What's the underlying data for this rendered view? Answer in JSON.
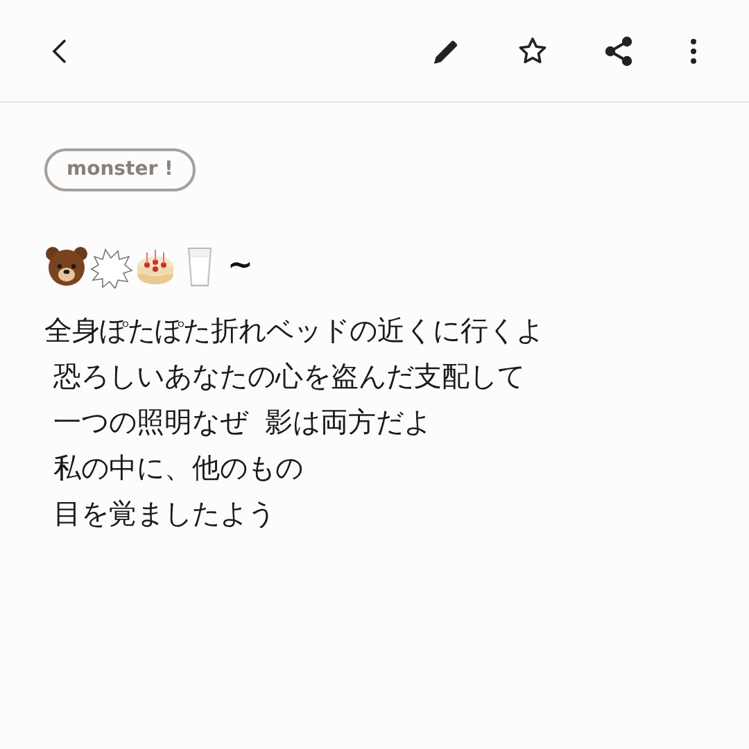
{
  "toolbar": {
    "actions": [
      {
        "kind": "edit"
      },
      {
        "kind": "favorite"
      },
      {
        "kind": "share"
      },
      {
        "kind": "more"
      }
    ]
  },
  "note": {
    "tag": "monster !",
    "emoji_line": {
      "trailing": "~"
    },
    "lines": [
      "全身ぽたぽた折れベッドの近くに行くよ",
      " 恐ろしいあなたの心を盗んだ支配して",
      " 一つの照明なぜ  影は両方だよ",
      " 私の中に、他のもの",
      " 目を覚ましたよう"
    ]
  }
}
